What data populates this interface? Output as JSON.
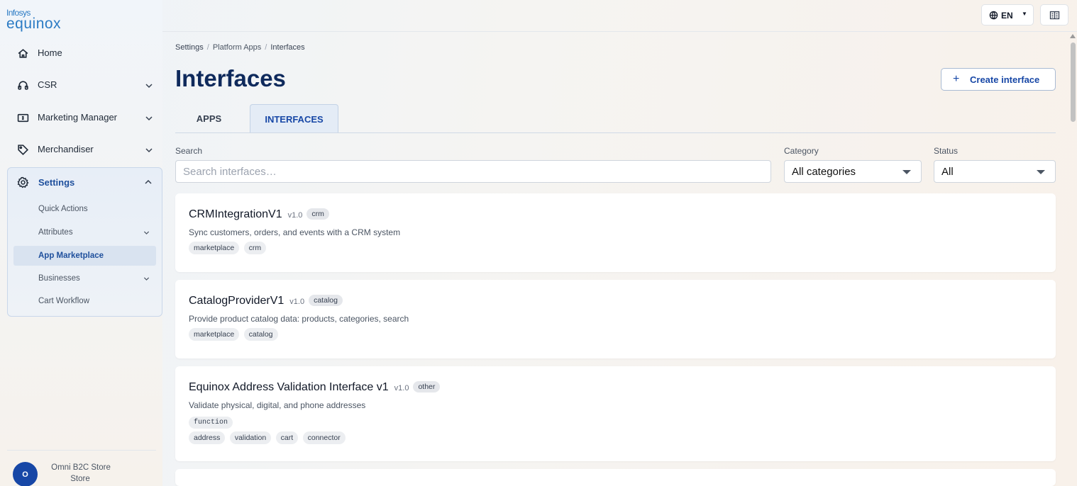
{
  "brand": {
    "line1": "Infosys",
    "line2": "equinox"
  },
  "sidebar": {
    "items": [
      {
        "label": "Home",
        "icon": "home-icon"
      },
      {
        "label": "CSR",
        "icon": "headset-icon"
      },
      {
        "label": "Marketing Manager",
        "icon": "money-icon"
      },
      {
        "label": "Merchandiser",
        "icon": "tag-icon"
      }
    ],
    "settings": {
      "label": "Settings",
      "icon": "gear-icon",
      "subitems": [
        {
          "label": "Quick Actions"
        },
        {
          "label": "Attributes"
        },
        {
          "label": "App Marketplace"
        },
        {
          "label": "Businesses"
        },
        {
          "label": "Cart Workflow"
        }
      ]
    },
    "store": {
      "avatar": "O",
      "name": "Omni B2C Store",
      "type": "Store"
    }
  },
  "topbar": {
    "language": "EN"
  },
  "breadcrumb": {
    "root": "Settings",
    "mid": "Platform Apps",
    "current": "Interfaces"
  },
  "page": {
    "title": "Interfaces",
    "create_label": "Create interface"
  },
  "tabs": [
    {
      "label": "APPS"
    },
    {
      "label": "INTERFACES"
    }
  ],
  "filters": {
    "search_label": "Search",
    "search_placeholder": "Search interfaces…",
    "category_label": "Category",
    "category_value": "All categories",
    "status_label": "Status",
    "status_value": "All"
  },
  "cards": [
    {
      "name": "CRMIntegrationV1",
      "version": "v1.0",
      "category": "crm",
      "description": "Sync customers, orders, and events with a CRM system",
      "tags": [
        "marketplace",
        "crm"
      ]
    },
    {
      "name": "CatalogProviderV1",
      "version": "v1.0",
      "category": "catalog",
      "description": "Provide product catalog data: products, categories, search",
      "tags": [
        "marketplace",
        "catalog"
      ]
    },
    {
      "name": "Equinox Address Validation Interface v1",
      "version": "v1.0",
      "category": "other",
      "description": "Validate physical, digital, and phone addresses",
      "type_tag": "function",
      "tags": [
        "address",
        "validation",
        "cart",
        "connector"
      ]
    }
  ],
  "colors": {
    "accent": "#1747a6",
    "title": "#0f2a5c"
  }
}
